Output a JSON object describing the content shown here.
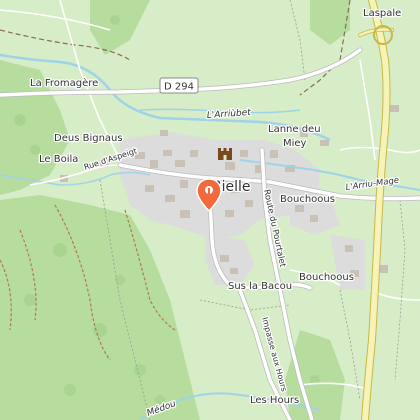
{
  "map": {
    "places": {
      "village": "Bielle",
      "laspale": "Laspale",
      "la_fromagere": "La Fromagère",
      "deus_bignaus": "Deus Bignaus",
      "le_boila": "Le Boila",
      "lanne_deu_miey_line1": "Lanne deu",
      "lanne_deu_miey_line2": "Miey",
      "bouchoous_1": "Bouchoous",
      "bouchoous_2": "Bouchoous",
      "sus_la_bacou": "Sus la Bacou",
      "les_hours": "Les Hours"
    },
    "roads": {
      "d294": "D 294",
      "rue_aspeigt": "Rue d'Aspeigt",
      "route_pourtalet": "Route du Pourtalet",
      "impasse_hours": "Impasse aux Hours"
    },
    "water": {
      "arriubet": "L'Arriùbet",
      "arriu_mage": "L'Arriu-Mage",
      "medou": "Médou"
    },
    "colors": {
      "background": "#d6edc8",
      "forest": "#b6dc9e",
      "urban": "#dcdcdc",
      "water": "#9fd3e8",
      "water_label": "#3a7fb0",
      "major_road_fill": "#f7f2b6",
      "major_road_casing": "#c8b84a",
      "road": "#ffffff",
      "road_casing": "#bbbbbb",
      "marker": "#f26a3c",
      "boundary": "#8b6b54"
    },
    "icons": {
      "location_marker": "map-pin-icon",
      "castle": "castle-icon"
    }
  }
}
